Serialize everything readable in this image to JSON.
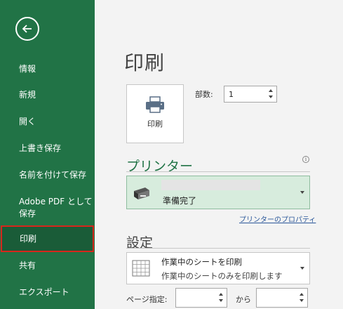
{
  "sidebar": {
    "back_icon": "arrow-left-icon",
    "items": [
      {
        "label": "情報"
      },
      {
        "label": "新規"
      },
      {
        "label": "開く"
      },
      {
        "label": "上書き保存"
      },
      {
        "label": "名前を付けて保存"
      },
      {
        "label": "Adobe PDF として\n保存"
      },
      {
        "label": "印刷",
        "active": true
      },
      {
        "label": "共有"
      },
      {
        "label": "エクスポート"
      }
    ]
  },
  "main": {
    "title": "印刷",
    "print_button": {
      "label": "印刷",
      "icon": "printer-icon"
    },
    "copies": {
      "label": "部数:",
      "value": "1"
    },
    "printer_section": {
      "heading": "プリンター",
      "status": "準備完了",
      "properties_link": "プリンターのプロパティ",
      "info_icon": "info-icon"
    },
    "settings_section": {
      "heading": "設定",
      "option_main": "作業中のシートを印刷",
      "option_sub": "作業中のシートのみを印刷します"
    },
    "pages": {
      "label": "ページ指定:",
      "to_label": "から",
      "from_value": "",
      "to_value": ""
    }
  },
  "colors": {
    "sidebar": "#217346",
    "active_border": "#d8261c",
    "printer_box": "#d7ecdd",
    "accent": "#217346"
  }
}
